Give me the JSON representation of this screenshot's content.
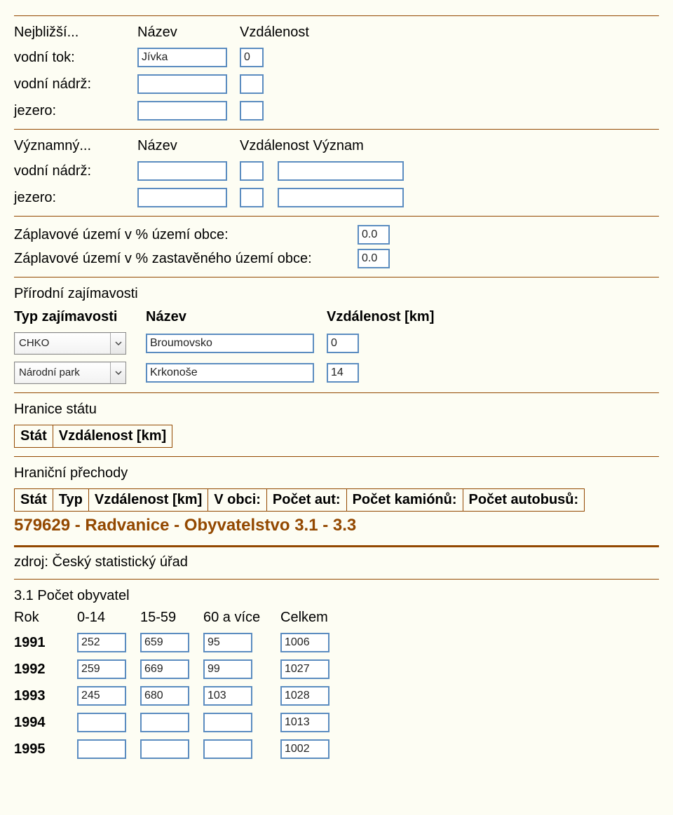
{
  "nearest": {
    "title": "Nejbližší...",
    "col_name": "Název",
    "col_dist": "Vzdálenost",
    "rows": [
      {
        "label": "vodní tok:",
        "name": "Jívka",
        "dist": "0"
      },
      {
        "label": "vodní nádrž:",
        "name": "",
        "dist": ""
      },
      {
        "label": "jezero:",
        "name": "",
        "dist": ""
      }
    ]
  },
  "significant": {
    "title": "Významný...",
    "col_name": "Název",
    "col_dist": "Vzdálenost",
    "col_sig": "Význam",
    "rows": [
      {
        "label": "vodní nádrž:",
        "name": "",
        "dist": "",
        "sig": ""
      },
      {
        "label": "jezero:",
        "name": "",
        "dist": "",
        "sig": ""
      }
    ]
  },
  "flood": {
    "row1_label": "Záplavové území v % území obce:",
    "row1_val": "0.0",
    "row2_label": "Záplavové území v % zastavěného území obce:",
    "row2_val": "0.0"
  },
  "nature": {
    "title": "Přírodní zajímavosti",
    "col_type": "Typ zajímavosti",
    "col_name": "Název",
    "col_dist": "Vzdálenost [km]",
    "rows": [
      {
        "type": "CHKO",
        "name": "Broumovsko",
        "dist": "0"
      },
      {
        "type": "Národní park",
        "name": "Krkonoše",
        "dist": "14"
      }
    ]
  },
  "border": {
    "title": "Hranice státu",
    "col_state": "Stát",
    "col_dist": "Vzdálenost [km]"
  },
  "crossings": {
    "title": "Hraniční přechody",
    "cols": [
      "Stát",
      "Typ",
      "Vzdálenost [km]",
      "V obci:",
      "Počet aut:",
      "Počet kamiónů:",
      "Počet autobusů:"
    ]
  },
  "population": {
    "heading": "579629 - Radvanice - Obyvatelstvo 3.1 - 3.3",
    "source": "zdroj: Český statistický úřad",
    "subhead": "3.1 Počet obyvatel",
    "cols": [
      "Rok",
      "0-14",
      "15-59",
      "60 a více",
      "Celkem"
    ],
    "rows": [
      {
        "year": "1991",
        "c0": "252",
        "c1": "659",
        "c2": "95",
        "c3": "1006"
      },
      {
        "year": "1992",
        "c0": "259",
        "c1": "669",
        "c2": "99",
        "c3": "1027"
      },
      {
        "year": "1993",
        "c0": "245",
        "c1": "680",
        "c2": "103",
        "c3": "1028"
      },
      {
        "year": "1994",
        "c0": "",
        "c1": "",
        "c2": "",
        "c3": "1013"
      },
      {
        "year": "1995",
        "c0": "",
        "c1": "",
        "c2": "",
        "c3": "1002"
      }
    ]
  }
}
